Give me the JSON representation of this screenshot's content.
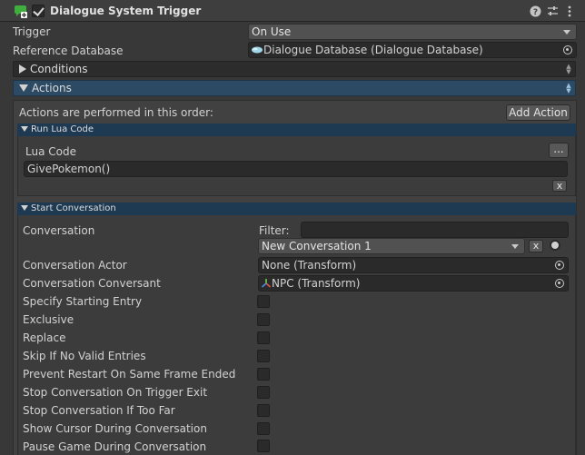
{
  "header": {
    "title": "Dialogue System Trigger",
    "help_icon": "help-icon",
    "settings_icon": "sliders-icon",
    "menu_icon": "kebab-menu-icon"
  },
  "trigger": {
    "label": "Trigger",
    "value": "On Use"
  },
  "reference_database": {
    "label": "Reference Database",
    "value": "Dialogue Database (Dialogue Database)"
  },
  "conditions": {
    "label": "Conditions"
  },
  "actions": {
    "label": "Actions",
    "order_text": "Actions are performed in this order:",
    "add_action_label": "Add Action"
  },
  "run_lua": {
    "header": "Run Lua Code",
    "lua_code_label": "Lua Code",
    "ellipsis_label": "...",
    "code_value": "GivePokemon()",
    "remove_label": "x"
  },
  "start_conversation": {
    "header": "Start Conversation",
    "conversation_label": "Conversation",
    "filter_label": "Filter:",
    "filter_value": "",
    "conversation_value": "New Conversation 1",
    "clear_label": "x",
    "actor_label": "Conversation Actor",
    "actor_value": "None (Transform)",
    "conversant_label": "Conversation Conversant",
    "conversant_value": "NPC (Transform)",
    "toggles": [
      {
        "label": "Specify Starting Entry",
        "checked": false
      },
      {
        "label": "Exclusive",
        "checked": false
      },
      {
        "label": "Replace",
        "checked": false
      },
      {
        "label": "Skip If No Valid Entries",
        "checked": false
      },
      {
        "label": "Prevent Restart On Same Frame Ended",
        "checked": false
      },
      {
        "label": "Stop Conversation On Trigger Exit",
        "checked": false
      },
      {
        "label": "Stop Conversation If Too Far",
        "checked": false
      },
      {
        "label": "Show Cursor During Conversation",
        "checked": false
      },
      {
        "label": "Pause Game During Conversation",
        "checked": false
      }
    ]
  },
  "colors": {
    "accent": "#2c4a63",
    "subheader": "#1e3a52",
    "background": "#383838"
  }
}
